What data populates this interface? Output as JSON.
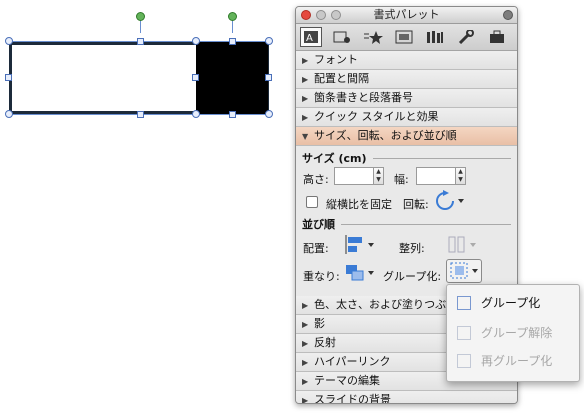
{
  "palette": {
    "title": "書式パレット",
    "toolbar": [
      "text-format-icon",
      "picture-icon",
      "bullets-star-icon",
      "slide-icon",
      "library-icon",
      "tools-icon",
      "briefcase-icon"
    ],
    "sections_top": [
      {
        "label": "フォント",
        "expanded": false
      },
      {
        "label": "配置と間隔",
        "expanded": false
      },
      {
        "label": "箇条書きと段落番号",
        "expanded": false
      },
      {
        "label": "クイック スタイルと効果",
        "expanded": false
      }
    ],
    "open_section": {
      "label": "サイズ、回転、および並び順",
      "expanded": true
    },
    "size": {
      "heading": "サイズ (cm)",
      "height_label": "高さ:",
      "height_value": "",
      "width_label": "幅:",
      "width_value": "",
      "lock_ratio_label": "縦横比を固定",
      "lock_ratio_checked": false,
      "rotation_label": "回転:"
    },
    "arrange": {
      "heading": "並び順",
      "position_label": "配置:",
      "align_label": "整列:",
      "order_label": "重なり:",
      "group_label": "グループ化:"
    },
    "sections_bottom": [
      {
        "label": "色、太さ、および塗りつぶし",
        "expanded": false
      },
      {
        "label": "影",
        "expanded": false
      },
      {
        "label": "反射",
        "expanded": false
      },
      {
        "label": "ハイパーリンク",
        "expanded": false
      },
      {
        "label": "テーマの編集",
        "expanded": false
      },
      {
        "label": "スライドの背景",
        "expanded": false
      }
    ]
  },
  "group_menu": [
    {
      "label": "グループ化",
      "enabled": true
    },
    {
      "label": "グループ解除",
      "enabled": false
    },
    {
      "label": "再グループ化",
      "enabled": false
    }
  ],
  "colors": {
    "accent_open_section": "#e9bfa6",
    "selection": "#6a8fd0",
    "rotate_handle": "#63b35a"
  }
}
